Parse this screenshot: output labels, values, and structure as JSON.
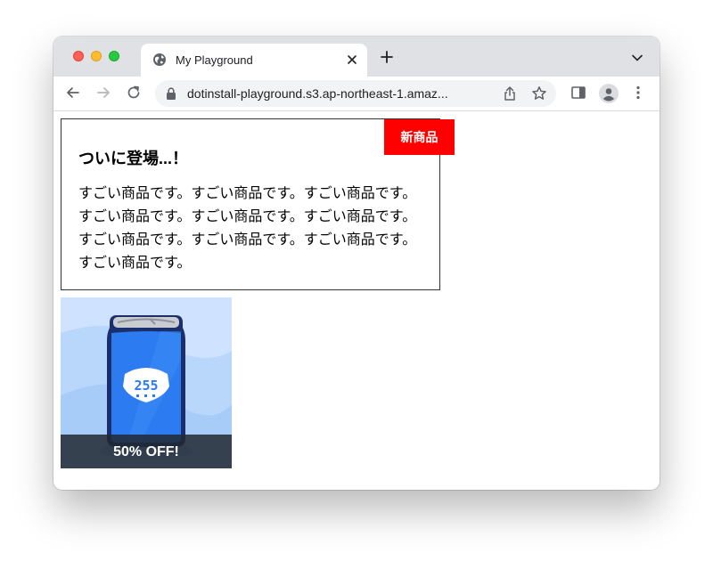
{
  "browser": {
    "tab_title": "My Playground",
    "url": "dotinstall-playground.s3.ap-northeast-1.amaz..."
  },
  "card": {
    "badge": "新商品",
    "heading": "ついに登場...！",
    "body": "すごい商品です。すごい商品です。すごい商品です。すごい商品です。すごい商品です。すごい商品です。すごい商品です。すごい商品です。すごい商品です。すごい商品です。"
  },
  "promo": {
    "caption": "50% OFF!",
    "can_logo": "255"
  },
  "colors": {
    "badge_bg": "#ff0000",
    "can_blue": "#2d7bf0",
    "caption_bg": "#222831"
  },
  "icons": [
    "globe-icon",
    "close-icon",
    "plus-icon",
    "chevron-down-icon",
    "back-arrow-icon",
    "forward-arrow-icon",
    "reload-icon",
    "lock-icon",
    "share-icon",
    "star-icon",
    "side-panel-icon",
    "profile-icon",
    "kebab-menu-icon"
  ]
}
